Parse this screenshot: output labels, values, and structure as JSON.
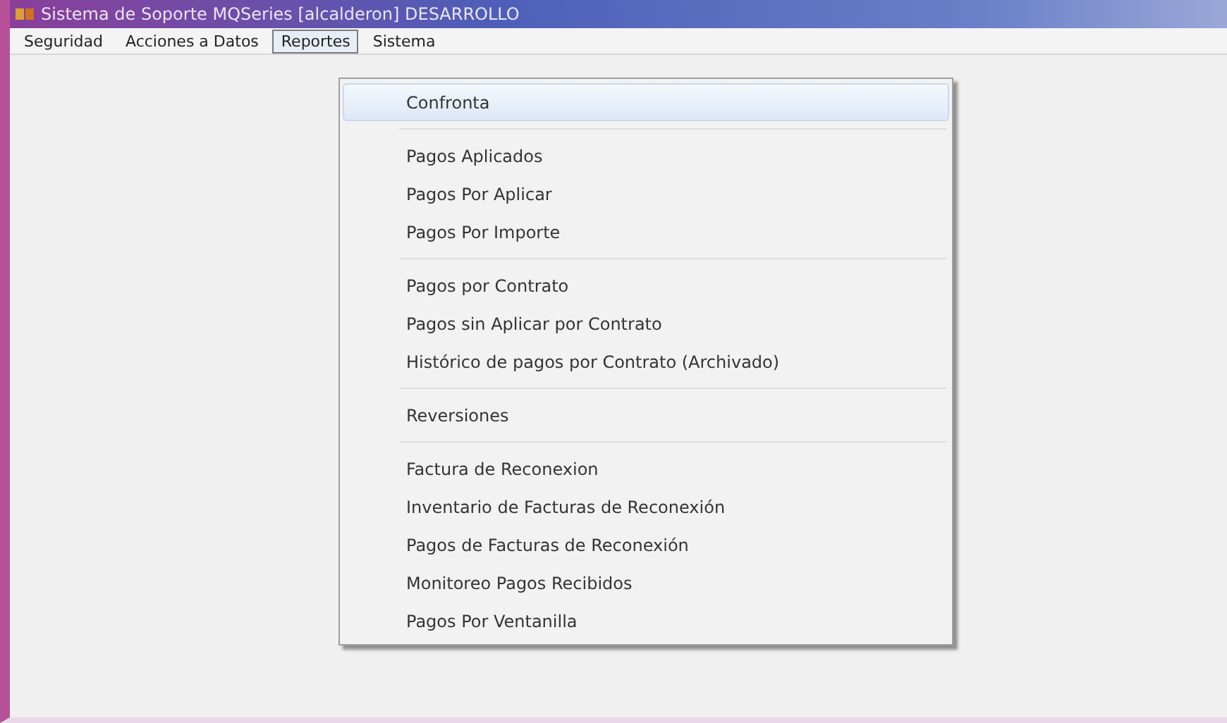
{
  "window": {
    "title": "Sistema de Soporte MQSeries [alcalderon] DESARROLLO"
  },
  "menu_bar": [
    {
      "label": "Seguridad",
      "selected": false
    },
    {
      "label": "Acciones a Datos",
      "selected": false
    },
    {
      "label": "Reportes",
      "selected": true
    },
    {
      "label": "Sistema",
      "selected": false
    }
  ],
  "dropdown": {
    "groups": [
      [
        {
          "label": "Confronta",
          "selected": true
        }
      ],
      [
        {
          "label": "Pagos Aplicados",
          "selected": false
        },
        {
          "label": "Pagos Por Aplicar",
          "selected": false
        },
        {
          "label": "Pagos Por Importe",
          "selected": false
        }
      ],
      [
        {
          "label": "Pagos por Contrato",
          "selected": false
        },
        {
          "label": "Pagos sin Aplicar por Contrato",
          "selected": false
        },
        {
          "label": "Histórico de pagos por Contrato (Archivado)",
          "selected": false
        }
      ],
      [
        {
          "label": "Reversiones",
          "selected": false
        }
      ],
      [
        {
          "label": "Factura de Reconexion",
          "selected": false
        },
        {
          "label": "Inventario de Facturas de Reconexión",
          "selected": false
        },
        {
          "label": "Pagos de Facturas de Reconexión",
          "selected": false
        },
        {
          "label": "Monitoreo Pagos Recibidos",
          "selected": false
        },
        {
          "label": "Pagos Por Ventanilla",
          "selected": false
        }
      ]
    ]
  }
}
